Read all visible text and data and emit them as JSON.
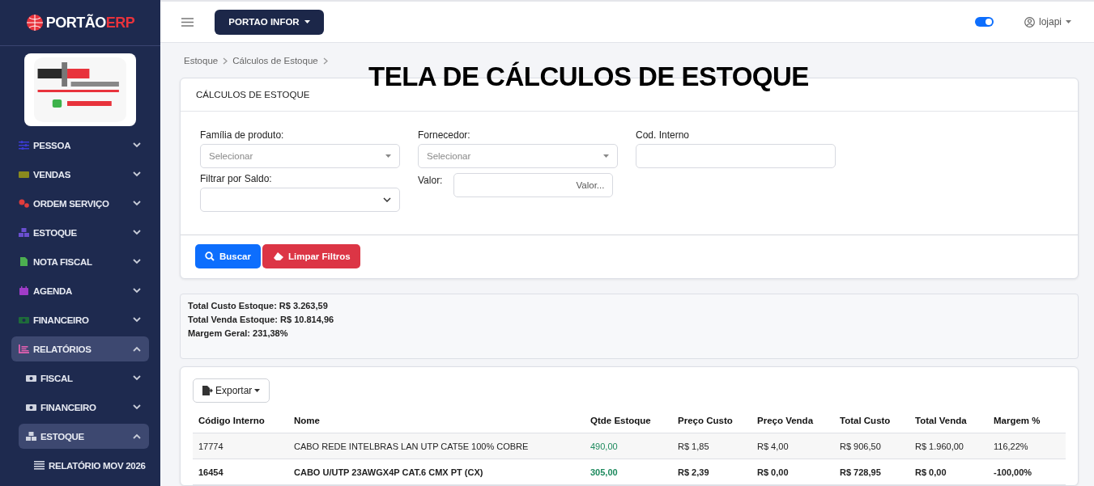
{
  "brand": {
    "name": "PORTÃO",
    "suffix": "ERP"
  },
  "sidebar_logo": {
    "kind": "picture"
  },
  "sidebar": {
    "items": [
      {
        "label": "PESSOA",
        "kind": "sliders",
        "color": "#3b3bd6",
        "expanded": false,
        "selected": false
      },
      {
        "label": "VENDAS",
        "kind": "ticket",
        "color": "#8a8a1e",
        "expanded": false,
        "selected": false
      },
      {
        "label": "ORDEM SERVIÇO",
        "kind": "gears",
        "color": "#e03c3c",
        "expanded": false,
        "selected": false
      },
      {
        "label": "ESTOQUE",
        "kind": "boxes",
        "color": "#6a4fd0",
        "expanded": false,
        "selected": false
      },
      {
        "label": "NOTA FISCAL",
        "kind": "file",
        "color": "#4caf50",
        "expanded": false,
        "selected": false
      },
      {
        "label": "AGENDA",
        "kind": "calendar",
        "color": "#a03cc8",
        "expanded": false,
        "selected": false
      },
      {
        "label": "FINANCEIRO",
        "kind": "money",
        "color": "#1e6b3a",
        "expanded": false,
        "selected": false
      },
      {
        "label": "RELATÓRIOS",
        "kind": "chart",
        "color": "#e060b0",
        "expanded": true,
        "selected": true,
        "children": [
          {
            "label": "FISCAL",
            "kind": "money",
            "color": "#d0d4e0",
            "expanded": false,
            "selected": false
          },
          {
            "label": "FINANCEIRO",
            "kind": "money",
            "color": "#d0d4e0",
            "expanded": false,
            "selected": false
          },
          {
            "label": "ESTOQUE",
            "kind": "boxes",
            "color": "#d0d4e0",
            "expanded": true,
            "selected": true,
            "children": [
              {
                "label": "RELATÓRIO MOV 2026",
                "kind": "list",
                "color": "#d0d4e0"
              }
            ]
          }
        ]
      }
    ]
  },
  "topbar": {
    "company": "PORTAO INFOR",
    "toggle": {
      "on": true
    },
    "user": "lojapi"
  },
  "breadcrumb": [
    "Estoque",
    "Cálculos de Estoque"
  ],
  "overlay_title": "TELA DE CÁLCULOS DE ESTOQUE",
  "filter_card": {
    "title": "CÁLCULOS DE ESTOQUE",
    "fields": {
      "familia": {
        "label": "Família de produto:",
        "placeholder": "Selecionar"
      },
      "fornecedor": {
        "label": "Fornecedor:",
        "placeholder": "Selecionar"
      },
      "cod_interno": {
        "label": "Cod. Interno"
      },
      "saldo": {
        "label": "Filtrar por Saldo:"
      },
      "valor": {
        "label": "Valor:",
        "placeholder": "Valor..."
      }
    },
    "buttons": {
      "search": "Buscar",
      "clear": "Limpar Filtros"
    }
  },
  "totals": [
    "Total Custo Estoque: R$ 3.263,59",
    "Total Venda Estoque: R$ 10.814,96",
    "Margem Geral: 231,38%"
  ],
  "table": {
    "export": "Exportar",
    "columns": [
      "Código Interno",
      "Nome",
      "Qtde Estoque",
      "Preço Custo",
      "Preço Venda",
      "Total Custo",
      "Total Venda",
      "Margem %"
    ],
    "rows": [
      {
        "bold": false,
        "cells": [
          "17774",
          "CABO REDE INTELBRAS LAN UTP CAT5E 100% COBRE",
          "490,00",
          "R$ 1,85",
          "R$ 4,00",
          "R$ 906,50",
          "R$ 1.960,00",
          "116,22%"
        ]
      },
      {
        "bold": true,
        "cells": [
          "16454",
          "CABO U/UTP 23AWGX4P CAT.6 CMX PT (CX)",
          "305,00",
          "R$ 2,39",
          "R$ 0,00",
          "R$ 728,95",
          "R$ 0,00",
          "-100,00%"
        ]
      }
    ]
  }
}
